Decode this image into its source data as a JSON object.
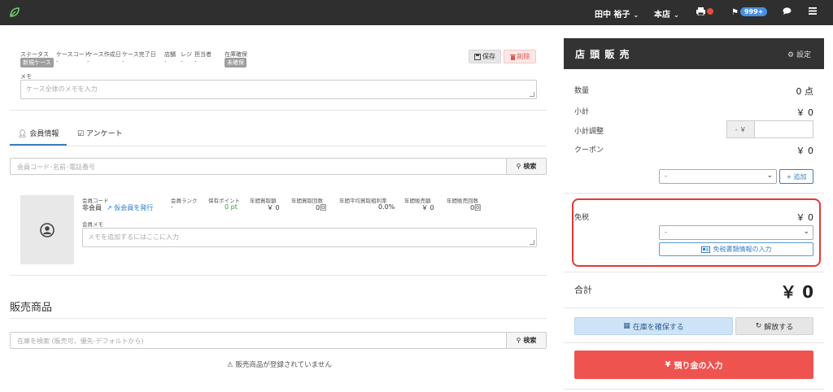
{
  "topbar": {
    "user_name": "田中 裕子",
    "store": "本店",
    "notification_count": "999+"
  },
  "case": {
    "status_label": "ステータス",
    "status_value": "新規ケース",
    "case_code_label": "ケースコード",
    "case_code_value": "-",
    "created_label": "ケース作成日",
    "created_value": "-",
    "completed_label": "ケース完了日",
    "completed_value": "-",
    "store_label": "店舗",
    "store_value": "-",
    "register_label": "レジ",
    "register_value": "-",
    "staff_label": "担当者",
    "staff_value": "-",
    "stock_label": "在庫確保",
    "stock_value": "未確保",
    "save_label": "保存",
    "delete_label": "削除",
    "memo_label": "メモ",
    "memo_placeholder": "ケース全体のメモを入力"
  },
  "tabs": {
    "member_info": "会員情報",
    "survey": "アンケート"
  },
  "member_search": {
    "placeholder": "会員コード･名前･電話番号",
    "button": "検索"
  },
  "member": {
    "code_label": "会員コード",
    "code_value": "非会員",
    "issue_temp_link": "仮会員を発行",
    "rank_label": "会員ランク",
    "rank_value": "-",
    "points_label": "保有ポイント",
    "points_value": "0 pt",
    "annual_buy_amount_label": "年間買取額",
    "annual_buy_amount_value": "￥ 0",
    "annual_buy_count_label": "年間買取回数",
    "annual_buy_count_value": "0回",
    "annual_avg_rate_label": "年間平均買取粗利率",
    "annual_avg_rate_value": "0.0%",
    "annual_sales_amount_label": "年間販売額",
    "annual_sales_amount_value": "￥ 0",
    "annual_sales_count_label": "年間販売回数",
    "annual_sales_count_value": "0回",
    "memo_label": "会員メモ",
    "memo_placeholder": "メモを追加するにはここに入力"
  },
  "products": {
    "title": "販売商品",
    "search_placeholder": "在庫を検索 (販売可、優先-デフォルトから)",
    "search_button": "検索",
    "empty_message": "販売商品が登録されていません"
  },
  "sales_panel": {
    "title": "店 頭 販 売",
    "settings": "設定",
    "quantity_label": "数量",
    "quantity_value": "0 点",
    "subtotal_label": "小計",
    "subtotal_value": "￥ 0",
    "adjust_label": "小計調整",
    "adjust_prefix": "- ￥",
    "coupon_label": "クーポン",
    "coupon_value": "￥ 0",
    "coupon_select": "-",
    "add_button": "追加",
    "taxfree_label": "免税",
    "taxfree_value": "￥ 0",
    "taxfree_select": "-",
    "taxfree_button": "免税書類情報の入力",
    "total_label": "合計",
    "total_value": "￥ 0",
    "reserve_button": "在庫を確保する",
    "release_button": "解放する",
    "deposit_button": "預り金の入力"
  },
  "colors": {
    "topbar": "#2f2f2f",
    "accent": "#3a7fc1",
    "danger": "#ef5350",
    "highlight": "#e53935",
    "points": "#2e9e3f"
  }
}
